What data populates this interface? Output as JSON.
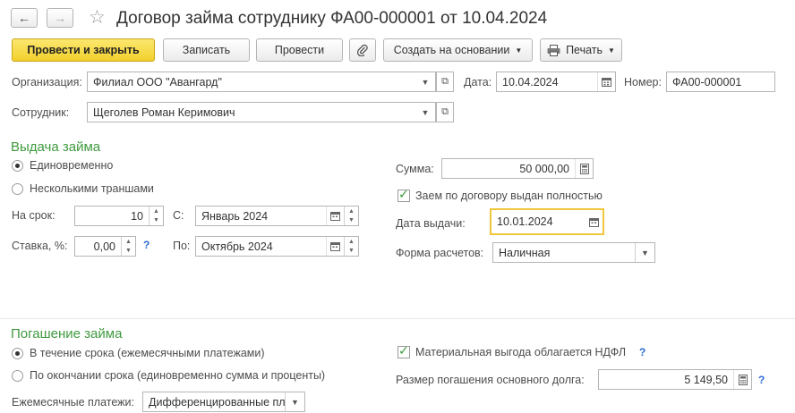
{
  "window": {
    "title": "Договор займа сотруднику ФА00-000001 от 10.04.2024"
  },
  "nav": {
    "back_glyph": "←",
    "forward_glyph": "→"
  },
  "toolbar": {
    "post_close": "Провести и закрыть",
    "save": "Записать",
    "post": "Провести",
    "create_based": "Создать на основании",
    "print": "Печать"
  },
  "header": {
    "org_label": "Организация:",
    "org_value": "Филиал ООО \"Авангард\"",
    "date_label": "Дата:",
    "date_value": "10.04.2024",
    "number_label": "Номер:",
    "number_value": "ФА00-000001",
    "employee_label": "Сотрудник:",
    "employee_value": "Щеголев Роман Керимович"
  },
  "issue": {
    "section_title": "Выдача займа",
    "radio_once": "Единовременно",
    "radio_tranches": "Несколькими траншами",
    "term_label": "На срок:",
    "term_value": "10",
    "from_label": "С:",
    "from_value": "Январь 2024",
    "rate_label": "Ставка, %:",
    "rate_value": "0,00",
    "to_label": "По:",
    "to_value": "Октябрь 2024",
    "help": "?",
    "sum_label": "Сумма:",
    "sum_value": "50 000,00",
    "issued_fully": "Заем по договору выдан полностью",
    "issue_date_label": "Дата выдачи:",
    "issue_date_value": "10.01.2024",
    "payment_form_label": "Форма расчетов:",
    "payment_form_value": "Наличная"
  },
  "repay": {
    "section_title": "Погашение займа",
    "radio_monthly": "В течение срока (ежемесячными платежами)",
    "radio_end": "По окончании срока (единовременно сумма и проценты)",
    "monthly_label": "Ежемесячные платежи:",
    "monthly_value": "Дифференцированные пл",
    "benefit_ndfl": "Материальная выгода облагается НДФЛ",
    "help": "?",
    "principal_label": "Размер погашения основного долга:",
    "principal_value": "5 149,50",
    "help2": "?"
  },
  "icons": {
    "star": "star-icon",
    "attachment": "paperclip-icon",
    "printer": "printer-icon",
    "calendar": "calendar-icon",
    "calculator": "calculator-icon",
    "open": "open-form-icon"
  }
}
